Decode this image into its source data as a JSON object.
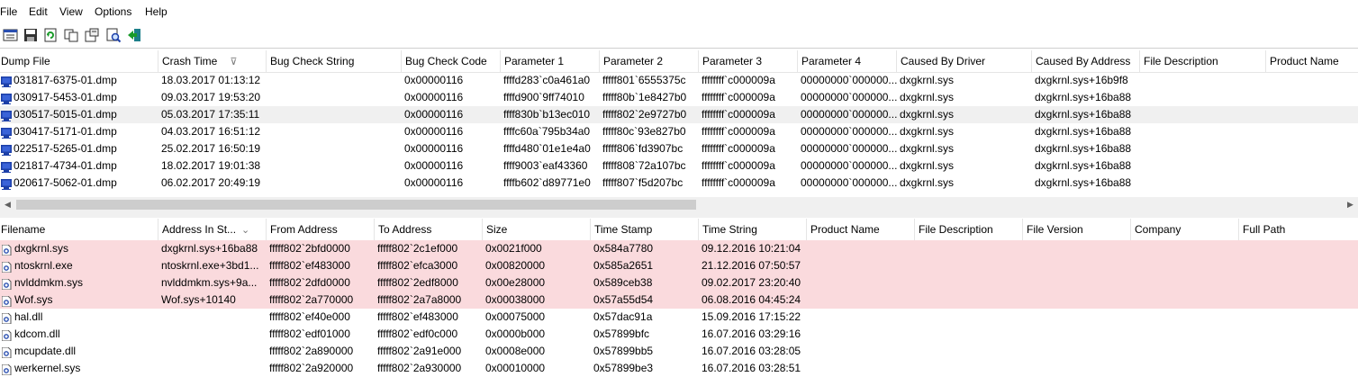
{
  "menu": [
    "File",
    "Edit",
    "View",
    "Options",
    "Help"
  ],
  "toolbar": [
    {
      "name": "properties-icon"
    },
    {
      "name": "save-icon"
    },
    {
      "name": "refresh-icon"
    },
    {
      "name": "copy-icon"
    },
    {
      "name": "options-icon"
    },
    {
      "name": "find-icon"
    },
    {
      "name": "exit-icon"
    }
  ],
  "dump_table": {
    "columns": [
      "Dump File",
      "Crash Time",
      "Bug Check String",
      "Bug Check Code",
      "Parameter 1",
      "Parameter 2",
      "Parameter 3",
      "Parameter 4",
      "Caused By Driver",
      "Caused By Address",
      "File Description",
      "Product Name"
    ],
    "sort_indicator": "⊽",
    "rows": [
      [
        "031817-6375-01.dmp",
        "18.03.2017 01:13:12",
        "",
        "0x00000116",
        "ffffd283`c0a461a0",
        "fffff801`6555375c",
        "ffffffff`c000009a",
        "00000000`000000...",
        "dxgkrnl.sys",
        "dxgkrnl.sys+16b9f8"
      ],
      [
        "030917-5453-01.dmp",
        "09.03.2017 19:53:20",
        "",
        "0x00000116",
        "ffffd900`9ff74010",
        "fffff80b`1e8427b0",
        "ffffffff`c000009a",
        "00000000`000000...",
        "dxgkrnl.sys",
        "dxgkrnl.sys+16ba88"
      ],
      [
        "030517-5015-01.dmp",
        "05.03.2017 17:35:11",
        "",
        "0x00000116",
        "ffff830b`b13ec010",
        "fffff802`2e9727b0",
        "ffffffff`c000009a",
        "00000000`000000...",
        "dxgkrnl.sys",
        "dxgkrnl.sys+16ba88"
      ],
      [
        "030417-5171-01.dmp",
        "04.03.2017 16:51:12",
        "",
        "0x00000116",
        "ffffc60a`795b34a0",
        "fffff80c`93e827b0",
        "ffffffff`c000009a",
        "00000000`000000...",
        "dxgkrnl.sys",
        "dxgkrnl.sys+16ba88"
      ],
      [
        "022517-5265-01.dmp",
        "25.02.2017 16:50:19",
        "",
        "0x00000116",
        "ffffd480`01e1e4a0",
        "fffff806`fd3907bc",
        "ffffffff`c000009a",
        "00000000`000000...",
        "dxgkrnl.sys",
        "dxgkrnl.sys+16ba88"
      ],
      [
        "021817-4734-01.dmp",
        "18.02.2017 19:01:38",
        "",
        "0x00000116",
        "ffff9003`eaf43360",
        "fffff808`72a107bc",
        "ffffffff`c000009a",
        "00000000`000000...",
        "dxgkrnl.sys",
        "dxgkrnl.sys+16ba88"
      ],
      [
        "020617-5062-01.dmp",
        "06.02.2017 20:49:19",
        "",
        "0x00000116",
        "ffffb602`d89771e0",
        "fffff807`f5d207bc",
        "ffffffff`c000009a",
        "00000000`000000...",
        "dxgkrnl.sys",
        "dxgkrnl.sys+16ba88"
      ]
    ]
  },
  "driver_table": {
    "columns": [
      "Filename",
      "Address In St...",
      "From Address",
      "To Address",
      "Size",
      "Time Stamp",
      "Time String",
      "Product Name",
      "File Description",
      "File Version",
      "Company",
      "Full Path"
    ],
    "sort_indicator": "⌄",
    "rows": [
      [
        "dxgkrnl.sys",
        "dxgkrnl.sys+16ba88",
        "fffff802`2bfd0000",
        "fffff802`2c1ef000",
        "0x0021f000",
        "0x584a7780",
        "09.12.2016 10:21:04"
      ],
      [
        "ntoskrnl.exe",
        "ntoskrnl.exe+3bd1...",
        "fffff802`ef483000",
        "fffff802`efca3000",
        "0x00820000",
        "0x585a2651",
        "21.12.2016 07:50:57"
      ],
      [
        "nvlddmkm.sys",
        "nvlddmkm.sys+9a...",
        "fffff802`2dfd0000",
        "fffff802`2edf8000",
        "0x00e28000",
        "0x589ceb38",
        "09.02.2017 23:20:40"
      ],
      [
        "Wof.sys",
        "Wof.sys+10140",
        "fffff802`2a770000",
        "fffff802`2a7a8000",
        "0x00038000",
        "0x57a55d54",
        "06.08.2016 04:45:24"
      ],
      [
        "hal.dll",
        "",
        "fffff802`ef40e000",
        "fffff802`ef483000",
        "0x00075000",
        "0x57dac91a",
        "15.09.2016 17:15:22"
      ],
      [
        "kdcom.dll",
        "",
        "fffff802`edf01000",
        "fffff802`edf0c000",
        "0x0000b000",
        "0x57899bfc",
        "16.07.2016 03:29:16"
      ],
      [
        "mcupdate.dll",
        "",
        "fffff802`2a890000",
        "fffff802`2a91e000",
        "0x0008e000",
        "0x57899bb5",
        "16.07.2016 03:28:05"
      ],
      [
        "werkernel.sys",
        "",
        "fffff802`2a920000",
        "fffff802`2a930000",
        "0x00010000",
        "0x57899be3",
        "16.07.2016 03:28:51"
      ]
    ]
  },
  "scroll_arrows": {
    "left": "◀",
    "right": "▶"
  },
  "colors": {
    "highlight": "#fadadd",
    "selected": "#f0f0f0",
    "icon_blue": "#1c3fa8"
  }
}
